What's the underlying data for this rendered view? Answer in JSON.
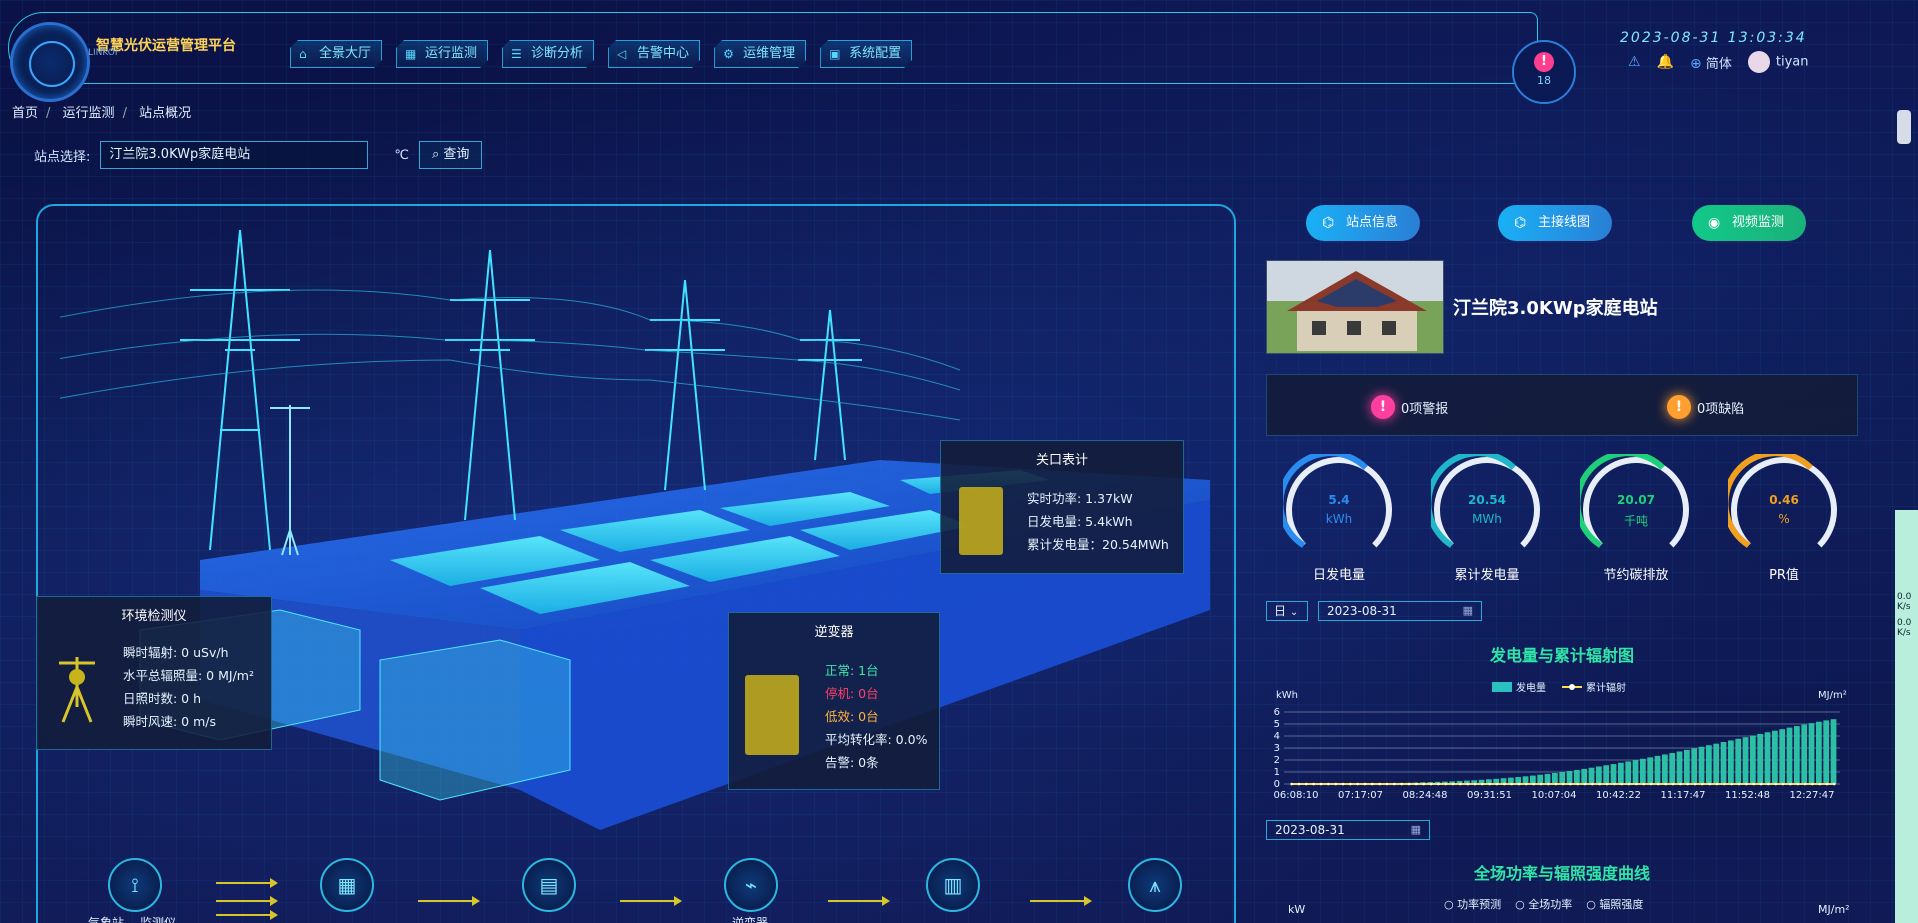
{
  "app": {
    "title": "智慧光伏运营管理平台",
    "logo_text": "LINKOI"
  },
  "nav": [
    {
      "label": "全景大厅",
      "icon": "home-icon"
    },
    {
      "label": "运行监测",
      "icon": "grid-icon"
    },
    {
      "label": "诊断分析",
      "icon": "list-icon"
    },
    {
      "label": "告警中心",
      "icon": "speaker-icon"
    },
    {
      "label": "运维管理",
      "icon": "gear-icon"
    },
    {
      "label": "系统配置",
      "icon": "settings-icon"
    }
  ],
  "header": {
    "alarm_count": "18",
    "datetime": "2023-08-31 13:03:34",
    "lang": "简体",
    "user": "tiyan"
  },
  "breadcrumb": [
    "首页",
    "运行监测",
    "站点概况"
  ],
  "search": {
    "label": "站点选择:",
    "value": "汀兰院3.0KWp家庭电站",
    "unit": "℃",
    "query_label": "查询"
  },
  "env_box": {
    "title": "环境检测仪",
    "rows": [
      "瞬时辐射: 0 uSv/h",
      "水平总辐照量: 0 MJ/m²",
      "日照时数: 0 h",
      "瞬时风速: 0 m/s"
    ]
  },
  "meter_box": {
    "title": "关口表计",
    "rows": [
      "实时功率: 1.37kW",
      "日发电量: 5.4kWh",
      "累计发电量：20.54MWh"
    ]
  },
  "inverter_box": {
    "title": "逆变器",
    "normal": "正常: 1台",
    "stopped": "停机: 0台",
    "low": "低效: 0台",
    "avg": "平均转化率: 0.0%",
    "alarm": "告警: 0条"
  },
  "flow": {
    "labels": [
      "气象站",
      "监测仪",
      "逆变器"
    ]
  },
  "right": {
    "buttons": {
      "site_info": "站点信息",
      "main_wiring": "主接线图",
      "video": "视频监测"
    },
    "station_name": "汀兰院3.0KWp家庭电站",
    "alarms": "0项警报",
    "defects": "0项缺陷",
    "gauges": [
      {
        "value": "5.4",
        "unit": "kWh",
        "label": "日发电量",
        "color": "#2a8cf0",
        "fraction": 0.62
      },
      {
        "value": "20.54",
        "unit": "MWh",
        "label": "累计发电量",
        "color": "#1fb7c9",
        "fraction": 0.62
      },
      {
        "value": "20.07",
        "unit": "千吨",
        "label": "节约碳排放",
        "color": "#1fd07a",
        "fraction": 0.62
      },
      {
        "value": "0.46",
        "unit": "%",
        "label": "PR值",
        "color": "#f0a020",
        "fraction": 0.62
      }
    ],
    "period": "日",
    "date1": "2023-08-31",
    "date2": "2023-08-31",
    "chart1_title": "发电量与累计辐射图",
    "chart2_title": "全场功率与辐照强度曲线",
    "chart2_legend": [
      "功率预测",
      "全场功率",
      "辐照强度"
    ],
    "chart2_unit_left": "kW",
    "chart2_unit_right": "MJ/m²"
  },
  "side": {
    "v1": "0.0",
    "u1": "K/s",
    "v2": "0.0",
    "u2": "K/s"
  },
  "chart_data": {
    "type": "bar",
    "title": "发电量与累计辐射图",
    "legend": [
      "发电量",
      "累计辐射"
    ],
    "ylabel_left": "kWh",
    "ylabel_right": "MJ/m²",
    "ylim": [
      0,
      6
    ],
    "yticks": [
      0,
      1,
      2,
      3,
      4,
      5,
      6
    ],
    "x_ticks": [
      "06:08:10",
      "07:17:07",
      "08:24:48",
      "09:31:51",
      "10:07:04",
      "10:42:22",
      "11:17:47",
      "11:52:48",
      "12:27:47"
    ],
    "series": [
      {
        "name": "发电量",
        "values": [
          0.01,
          0.01,
          0.01,
          0.01,
          0.02,
          0.02,
          0.02,
          0.03,
          0.03,
          0.04,
          0.04,
          0.05,
          0.06,
          0.07,
          0.08,
          0.09,
          0.1,
          0.12,
          0.14,
          0.16,
          0.18,
          0.2,
          0.22,
          0.25,
          0.28,
          0.31,
          0.35,
          0.39,
          0.43,
          0.48,
          0.53,
          0.58,
          0.64,
          0.7,
          0.77,
          0.84,
          0.92,
          1.0,
          1.08,
          1.17,
          1.26,
          1.36,
          1.46,
          1.56,
          1.66,
          1.77,
          1.88,
          1.99,
          2.1,
          2.22,
          2.34,
          2.46,
          2.58,
          2.71,
          2.84,
          2.97,
          3.1,
          3.23,
          3.36,
          3.5,
          3.63,
          3.77,
          3.9,
          4.04,
          4.17,
          4.31,
          4.44,
          4.57,
          4.7,
          4.83,
          4.95,
          5.07,
          5.19,
          5.3,
          5.4
        ]
      },
      {
        "name": "累计辐射",
        "values": [
          0,
          0,
          0,
          0,
          0,
          0,
          0,
          0,
          0,
          0,
          0,
          0,
          0,
          0,
          0,
          0,
          0,
          0,
          0,
          0,
          0,
          0,
          0,
          0,
          0,
          0,
          0,
          0,
          0,
          0,
          0,
          0,
          0,
          0,
          0,
          0,
          0,
          0,
          0,
          0,
          0,
          0,
          0,
          0,
          0,
          0,
          0,
          0,
          0,
          0,
          0,
          0,
          0,
          0,
          0,
          0,
          0,
          0,
          0,
          0,
          0,
          0,
          0,
          0,
          0,
          0,
          0,
          0,
          0,
          0,
          0,
          0,
          0,
          0,
          0
        ]
      }
    ]
  }
}
